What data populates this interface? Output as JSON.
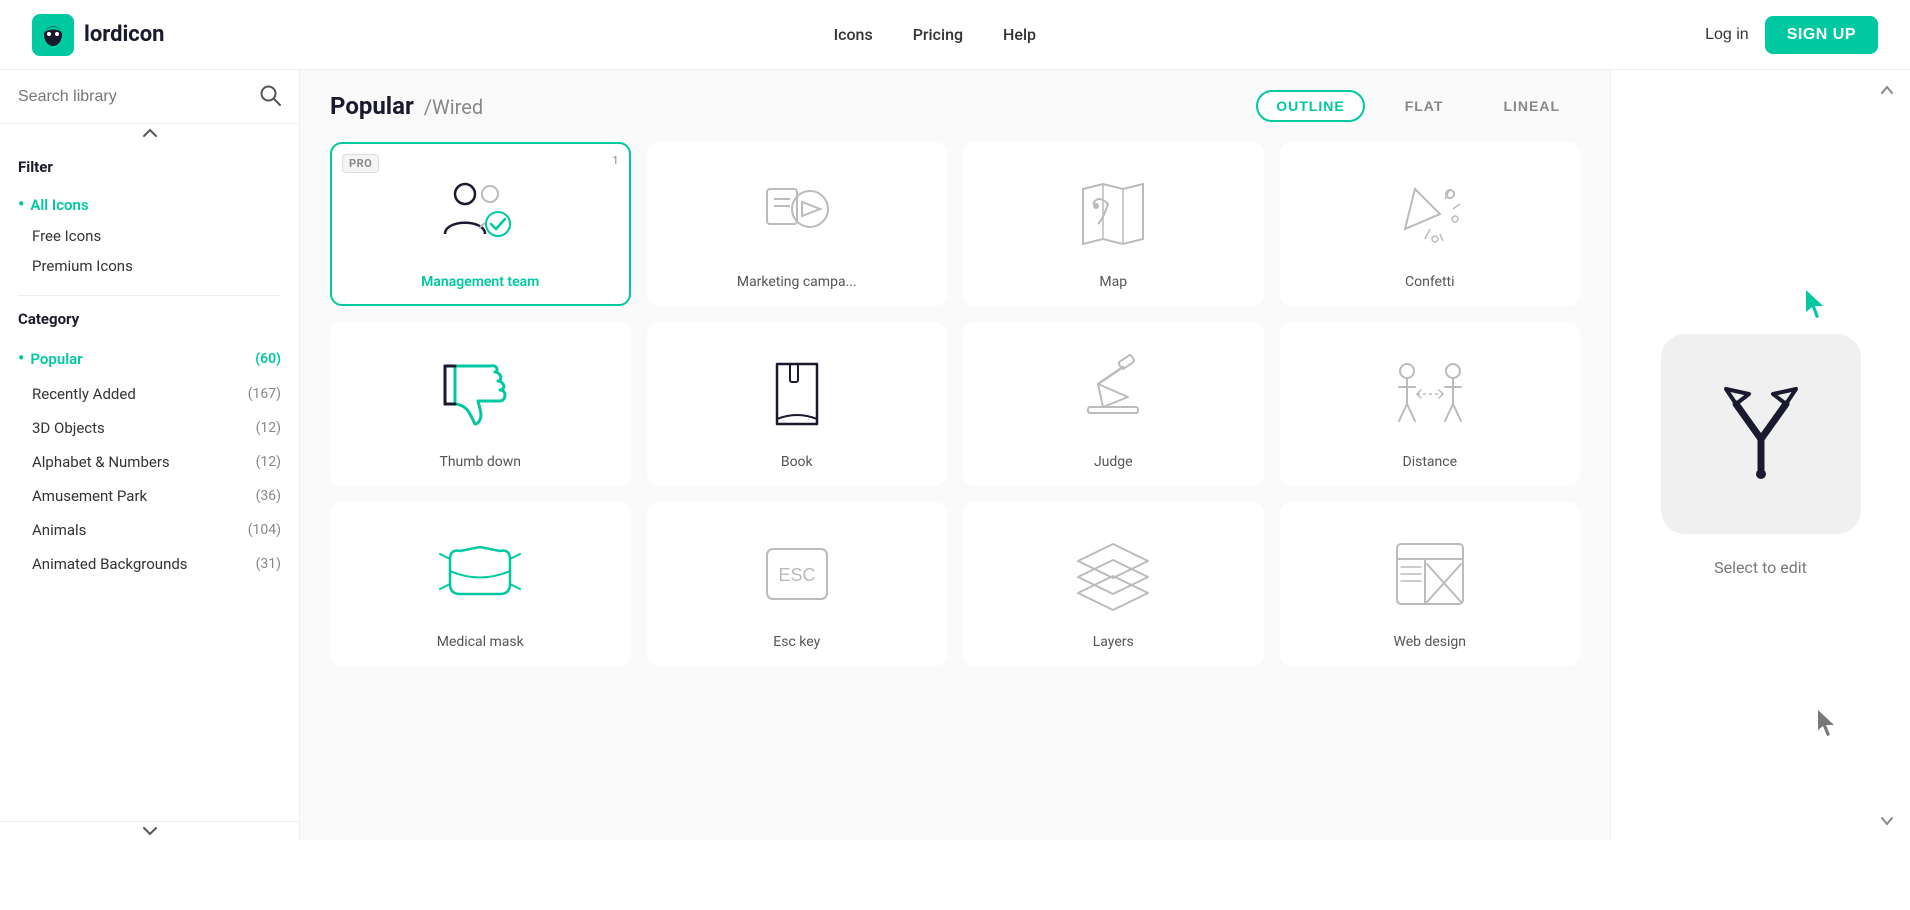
{
  "header": {
    "logo_text": "lordicon",
    "nav_items": [
      {
        "label": "Icons",
        "href": "#"
      },
      {
        "label": "Pricing",
        "href": "#"
      },
      {
        "label": "Help",
        "href": "#"
      }
    ],
    "login_label": "Log in",
    "signup_label": "SIGN UP"
  },
  "sidebar": {
    "search_placeholder": "Search library",
    "filter_section_title": "Filter",
    "filter_items": [
      {
        "label": "All Icons",
        "active": true
      },
      {
        "label": "Free Icons",
        "active": false
      },
      {
        "label": "Premium Icons",
        "active": false
      }
    ],
    "category_section_title": "Category",
    "categories": [
      {
        "label": "Popular",
        "count": 60,
        "active": true
      },
      {
        "label": "Recently Added",
        "count": 167,
        "active": false
      },
      {
        "label": "3D Objects",
        "count": 12,
        "active": false
      },
      {
        "label": "Alphabet & Numbers",
        "count": 12,
        "active": false
      },
      {
        "label": "Amusement Park",
        "count": 36,
        "active": false
      },
      {
        "label": "Animals",
        "count": 104,
        "active": false
      },
      {
        "label": "Animated Backgrounds",
        "count": 31,
        "active": false
      }
    ]
  },
  "content": {
    "title": "Popular",
    "subtitle": "/Wired",
    "style_tabs": [
      {
        "label": "OUTLINE",
        "active": true
      },
      {
        "label": "FLAT",
        "active": false
      },
      {
        "label": "LINEAL",
        "active": false
      }
    ],
    "icons": [
      {
        "label": "Management team",
        "pro": true,
        "pro_num": 1,
        "selected": true,
        "style": "management"
      },
      {
        "label": "Marketing campa...",
        "pro": false,
        "pro_num": null,
        "selected": false,
        "style": "marketing"
      },
      {
        "label": "Map",
        "pro": false,
        "pro_num": null,
        "selected": false,
        "style": "map"
      },
      {
        "label": "Confetti",
        "pro": false,
        "pro_num": null,
        "selected": false,
        "style": "confetti"
      },
      {
        "label": "Thumb down",
        "pro": false,
        "pro_num": null,
        "selected": false,
        "style": "thumbdown"
      },
      {
        "label": "Book",
        "pro": false,
        "pro_num": null,
        "selected": false,
        "style": "book"
      },
      {
        "label": "Judge",
        "pro": false,
        "pro_num": null,
        "selected": false,
        "style": "judge"
      },
      {
        "label": "Distance",
        "pro": false,
        "pro_num": null,
        "selected": false,
        "style": "distance"
      },
      {
        "label": "Medical mask",
        "pro": false,
        "pro_num": null,
        "selected": false,
        "style": "mask"
      },
      {
        "label": "Esc key",
        "pro": false,
        "pro_num": null,
        "selected": false,
        "style": "esc"
      },
      {
        "label": "Layers",
        "pro": false,
        "pro_num": null,
        "selected": false,
        "style": "layers"
      },
      {
        "label": "Web design",
        "pro": false,
        "pro_num": null,
        "selected": false,
        "style": "webdesign"
      }
    ]
  },
  "right_panel": {
    "select_to_edit": "Select to edit"
  }
}
